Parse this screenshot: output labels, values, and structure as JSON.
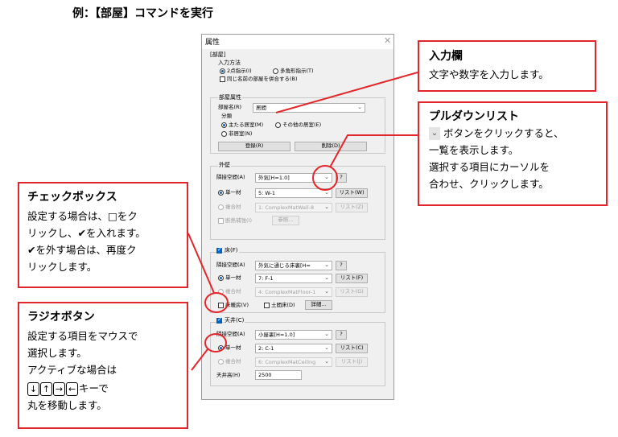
{
  "caption": "例：【部屋】コマンドを実行",
  "dialog": {
    "title": "属性",
    "close_icon": "close-icon",
    "header": "[部屋]",
    "input_method": {
      "label": "入力方法",
      "opt_2pt": "2点指示(I)",
      "opt_poly": "多角形指示(T)",
      "merge_same": "同じ名前の部屋を併合する(B)"
    },
    "room_attr": {
      "label": "部屋属性",
      "name_label": "部屋名(R)",
      "name_value": "居間",
      "class_label": "分類",
      "opt_main": "主たる居室(M)",
      "opt_other": "その他の居室(E)",
      "opt_non": "非居室(N)",
      "register": "登録(R)",
      "delete": "削除(D)"
    },
    "outer_wall": {
      "label": "外壁",
      "adj_label": "隣接空間(A)",
      "adj_value": "外気[H=1.0]",
      "help": "?",
      "single_label": "単一材",
      "single_value": "5: W-1",
      "list_single": "リスト(W)",
      "composite_label": "複合材",
      "composite_value": "1: ComplexMatWall-8",
      "list_composite": "リスト(Z)",
      "insulation_label": "断熱補強(I)",
      "ref_button": "参照..."
    },
    "floor": {
      "label": "床(F)",
      "adj_label": "隣接空間(A)",
      "adj_value": "外気に通じる床裏[H=",
      "help": "?",
      "single_label": "単一材",
      "single_value": "7: F-1",
      "list_single": "リスト(F)",
      "composite_label": "複合材",
      "composite_value": "4: ComplexMatFloor-1",
      "list_composite": "リスト(G)",
      "floor_heat": "床暖房(V)",
      "earth_floor": "土間床(D)",
      "detail": "詳細..."
    },
    "ceiling": {
      "label": "天井(C)",
      "adj_label": "隣接空間(A)",
      "adj_value": "小屋裏[H=1.0]",
      "help": "?",
      "single_label": "単一材",
      "single_value": "2: C-1",
      "list_single": "リスト(C)",
      "composite_label": "複合材",
      "composite_value": "6: ComplexMatCeiling",
      "list_composite": "リスト(J)",
      "height_label": "天井高(H)",
      "height_value": "2500"
    }
  },
  "callouts": {
    "input": {
      "title": "入力欄",
      "body": [
        "文字や数字を入力します。"
      ]
    },
    "pulldown": {
      "title": "プルダウンリスト",
      "body": [
        "ボタンをクリックすると、",
        "一覧を表示します。",
        "選択する項目にカーソルを",
        "合わせ、クリックします。"
      ]
    },
    "checkbox": {
      "title": "チェックボックス",
      "body": [
        "設定する場合は、□をク",
        "リックし、✔を入れます。",
        "✔を外す場合は、再度ク",
        "リックします。"
      ]
    },
    "radio": {
      "title": "ラジオボタン",
      "body": [
        "設定する項目をマウスで",
        "選択します。",
        "アクティブな場合は",
        "キーで",
        "丸を移動します。"
      ],
      "keys": [
        "↓",
        "↑",
        "→",
        "←"
      ]
    }
  },
  "colors": {
    "accent": "#e3262b",
    "selection": "#0063c0"
  }
}
